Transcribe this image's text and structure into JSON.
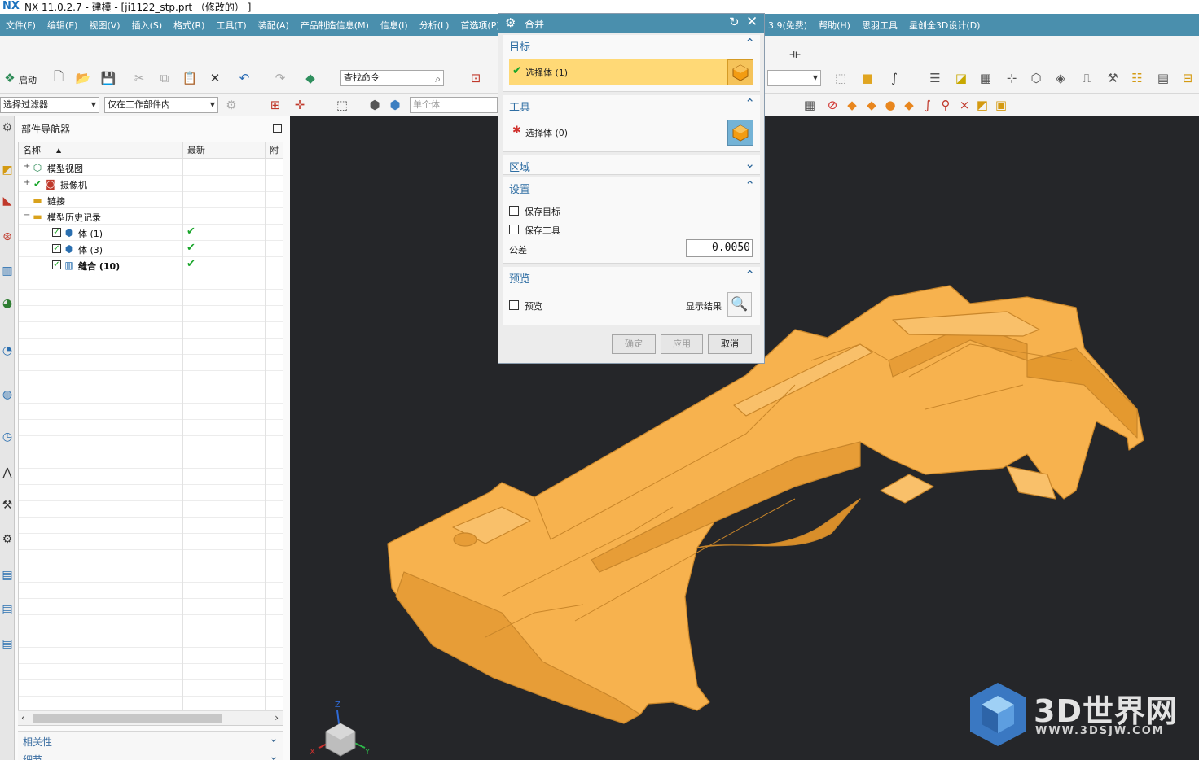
{
  "window": {
    "title": "NX 11.0.2.7 - 建模 - [ji1122_stp.prt （修改的） ]",
    "logo": "NX"
  },
  "menubar": {
    "left_items": [
      "文件(F)",
      "编辑(E)",
      "视图(V)",
      "插入(S)",
      "格式(R)",
      "工具(T)",
      "装配(A)",
      "产品制造信息(M)",
      "信息(I)",
      "分析(L)",
      "首选项(P)"
    ],
    "right_items": [
      "3.9(免费)",
      "帮助(H)",
      "思羽工具",
      "星创全3D设计(D)"
    ],
    "bar_color": "#4a8fad"
  },
  "toolbar": {
    "start_label": "启动",
    "search_placeholder": "查找命令",
    "filter_value": "选择过滤器",
    "scope_value": "仅在工作部件内",
    "body_value": "单个体"
  },
  "navigator": {
    "title": "部件导航器",
    "columns": [
      "名称",
      "最新",
      "附"
    ],
    "rows": [
      {
        "label": "模型视图",
        "expander": "+",
        "icon": "model-views-icon",
        "level": 0
      },
      {
        "label": "摄像机",
        "expander": "+",
        "icon": "camera-icon",
        "level": 0
      },
      {
        "label": "链接",
        "expander": "",
        "icon": "folder-icon",
        "level": 0
      },
      {
        "label": "模型历史记录",
        "expander": "−",
        "icon": "folder-open-icon",
        "level": 0
      },
      {
        "label": "体 (1)",
        "expander": "",
        "icon": "body-icon",
        "level": 1,
        "latest": "✔"
      },
      {
        "label": "体 (3)",
        "expander": "",
        "icon": "body-icon",
        "level": 1,
        "latest": "✔"
      },
      {
        "label": "缝合 (10)",
        "expander": "",
        "icon": "sew-icon",
        "level": 1,
        "latest": "✔",
        "bold": true
      }
    ],
    "panels": [
      "相关性",
      "细节"
    ]
  },
  "dialog": {
    "title": "合并",
    "target": {
      "heading": "目标",
      "selection": "选择体 (1)",
      "status": "✔"
    },
    "tool": {
      "heading": "工具",
      "selection": "选择体 (0)",
      "status": "✱"
    },
    "region": {
      "heading": "区域"
    },
    "settings": {
      "heading": "设置",
      "keep_target": "保存目标",
      "keep_tool": "保存工具",
      "tolerance_label": "公差",
      "tolerance_value": "0.0050"
    },
    "preview": {
      "heading": "预览",
      "preview_label": "预览",
      "show_result_label": "显示结果"
    },
    "buttons": {
      "ok": "确定",
      "apply": "应用",
      "cancel": "取消"
    }
  },
  "viewport": {
    "background": "#252629",
    "model_color": "#f7b24e",
    "triad_z": "Z",
    "triad_x": "X",
    "triad_y": "Y"
  },
  "watermark": {
    "name": "3D世界网",
    "url": "WWW.3DSJW.COM"
  }
}
